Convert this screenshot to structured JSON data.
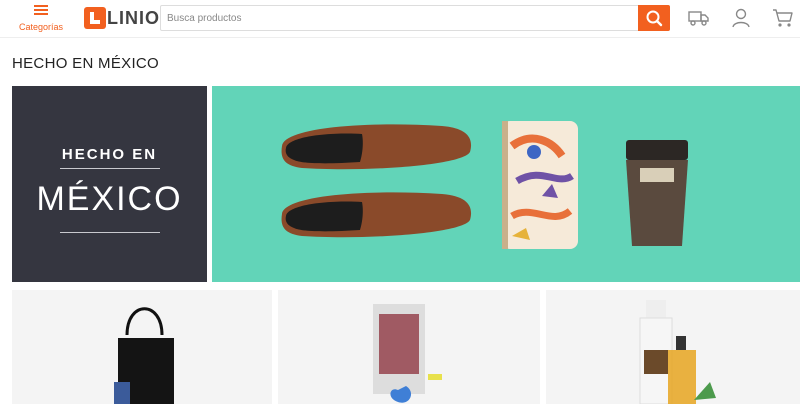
{
  "header": {
    "categories_label": "Categorías",
    "logo_text": "LINIO",
    "search_placeholder": "Busca productos",
    "accent_color": "#f2601f"
  },
  "icons": {
    "menu": "hamburger-icon",
    "search": "search-icon",
    "shipping": "truck-icon",
    "account": "user-icon",
    "cart": "cart-icon"
  },
  "page": {
    "title": "HECHO EN MÉXICO"
  },
  "hero": {
    "line1": "HECHO EN",
    "line2": "MÉXICO",
    "left_bg": "#353640",
    "right_bg": "#62d4b8"
  },
  "products": [
    {
      "name": "tote-bag"
    },
    {
      "name": "decor-piece"
    },
    {
      "name": "oil-bottles"
    }
  ]
}
